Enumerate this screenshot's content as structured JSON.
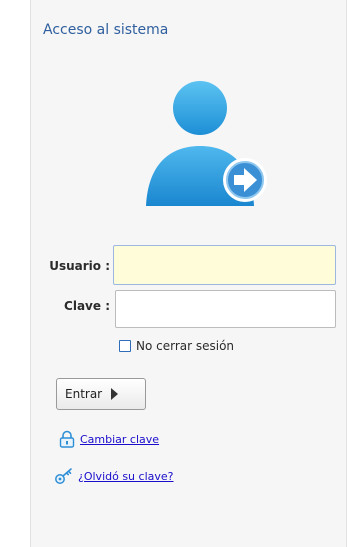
{
  "title": "Acceso al sistema",
  "form": {
    "user_label": "Usuario :",
    "user_value": "",
    "password_label": "Clave :",
    "password_value": "",
    "remember_label": "No cerrar sesión",
    "remember_checked": false,
    "submit_label": "Entrar"
  },
  "links": {
    "change_password": "Cambiar clave",
    "forgot_password": "¿Olvidó su clave?"
  },
  "icons": {
    "avatar": "user-login-icon",
    "submit": "play-arrow-icon",
    "change_password": "padlock-icon",
    "forgot_password": "key-icon"
  },
  "colors": {
    "title": "#2f5f9e",
    "avatar": "#2f9ee0",
    "user_field_bg": "#fffcd9",
    "link": "#1a0dcc"
  }
}
